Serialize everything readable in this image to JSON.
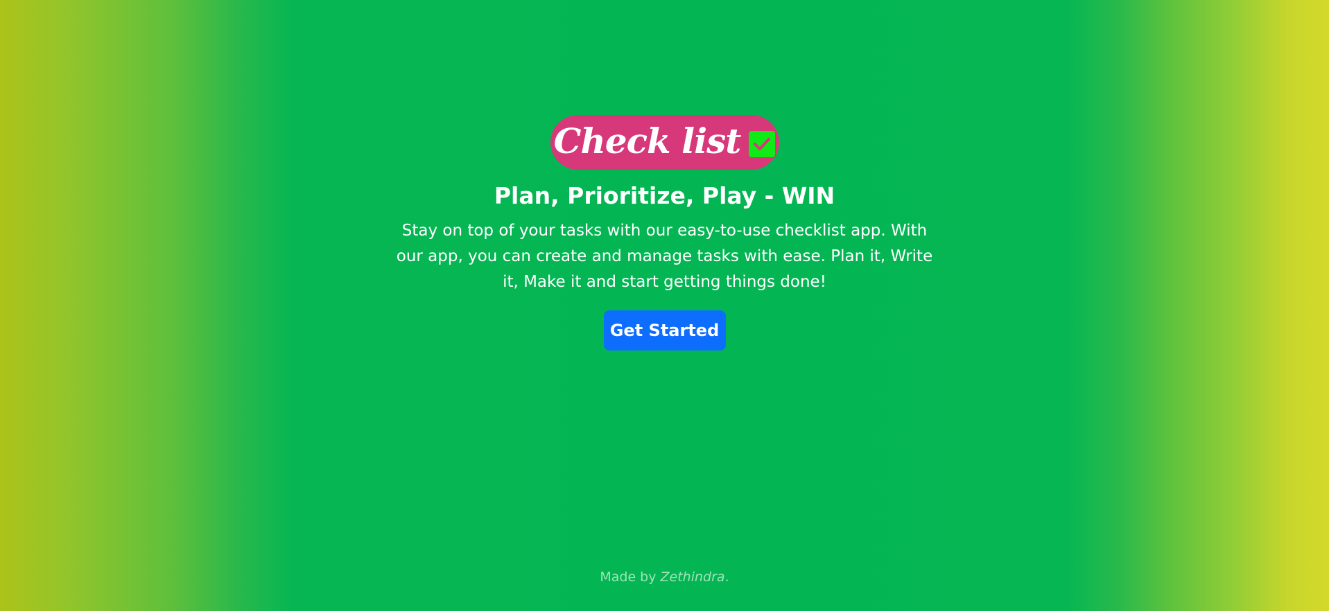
{
  "brand": {
    "logo_text": "Check list",
    "logo_color": "#d6387a",
    "check_icon": "checkbox-checked-icon",
    "check_color": "#10ea16"
  },
  "hero": {
    "tagline": "Plan, Prioritize, Play - WIN",
    "description": "Stay on top of your tasks with our easy-to-use checklist app. With our app, you can create and manage tasks with ease. Plan it, Write it, Make it and start getting things done!",
    "cta_label": "Get Started",
    "cta_color": "#0d6efd"
  },
  "footer": {
    "prefix": "Made by ",
    "author": "Zethindra",
    "suffix": "."
  },
  "colors": {
    "background_center": "#04b653",
    "background_edge_left": "#acc319",
    "background_edge_right": "#d4d92b"
  }
}
